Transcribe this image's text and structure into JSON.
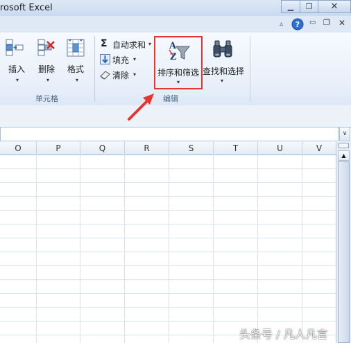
{
  "window": {
    "title": "rosoft Excel"
  },
  "cells_group": {
    "label": "单元格",
    "insert_label": "插入",
    "delete_label": "删除",
    "format_label": "格式"
  },
  "edit_group": {
    "label": "编辑",
    "autosum_label": "自动求和",
    "fill_label": "填充",
    "clear_label": "清除",
    "sort_filter_label": "排序和筛选",
    "find_select_label": "查找和选择"
  },
  "columns": [
    "O",
    "P",
    "Q",
    "R",
    "S",
    "T",
    "U",
    "V"
  ],
  "watermark": "头条号 / 凡人凡言",
  "colors": {
    "highlight": "#e8332e",
    "arrow": "#e8332e",
    "ribbon": "#e6eef9"
  }
}
